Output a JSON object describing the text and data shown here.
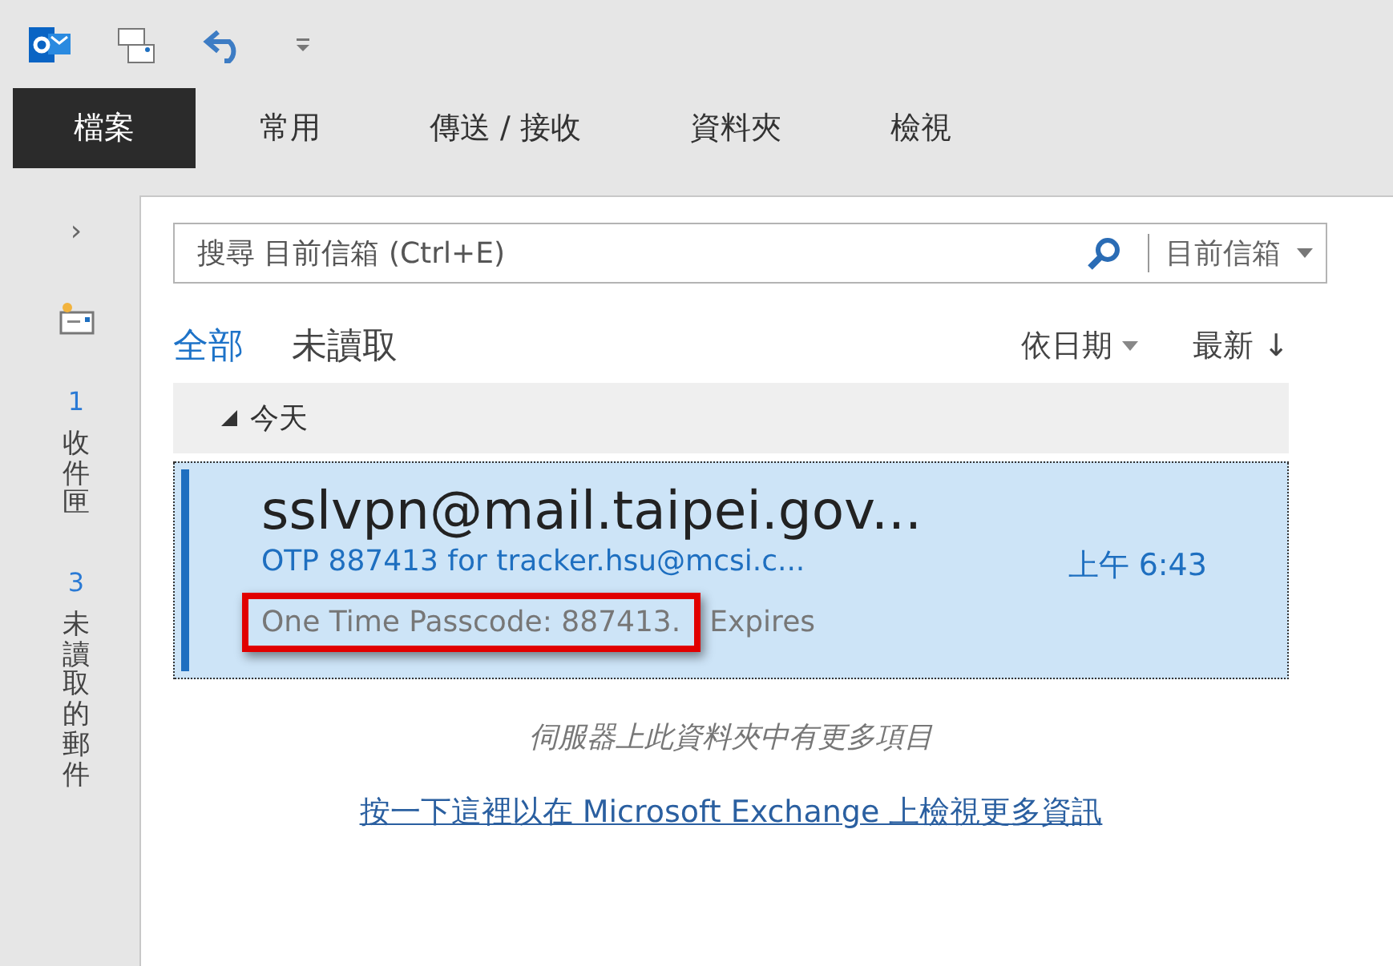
{
  "ribbon_tabs": [
    {
      "label": "檔案",
      "selected": true
    },
    {
      "label": "常用",
      "selected": false
    },
    {
      "label": "傳送 / 接收",
      "selected": false
    },
    {
      "label": "資料夾",
      "selected": false
    },
    {
      "label": "檢視",
      "selected": false
    }
  ],
  "sidebar": {
    "expand": "›",
    "folders": [
      {
        "name": "收件匣",
        "count": "1"
      },
      {
        "name": "未讀取的郵件",
        "count": "3"
      }
    ]
  },
  "search": {
    "placeholder": "搜尋 目前信箱 (Ctrl+E)",
    "scope": "目前信箱"
  },
  "filters": [
    {
      "label": "全部",
      "selected": true
    },
    {
      "label": "未讀取",
      "selected": false
    }
  ],
  "sort": {
    "by": "依日期",
    "order": "最新 ↓"
  },
  "group": {
    "label": "今天",
    "expanded": true
  },
  "messages": [
    {
      "sender": "sslvpn@mail.taipei.gov...",
      "subject": "OTP 887413 for tracker.hsu@mcsi.c...",
      "time": "上午 6:43",
      "preview": "One Time Passcode: 887413.",
      "preview_rest": "Expires",
      "selected": true,
      "highlighted": true
    }
  ],
  "footer": {
    "note": "伺服器上此資料夾中有更多項目",
    "link": "按一下這裡以在 Microsoft Exchange 上檢視更多資訊"
  }
}
